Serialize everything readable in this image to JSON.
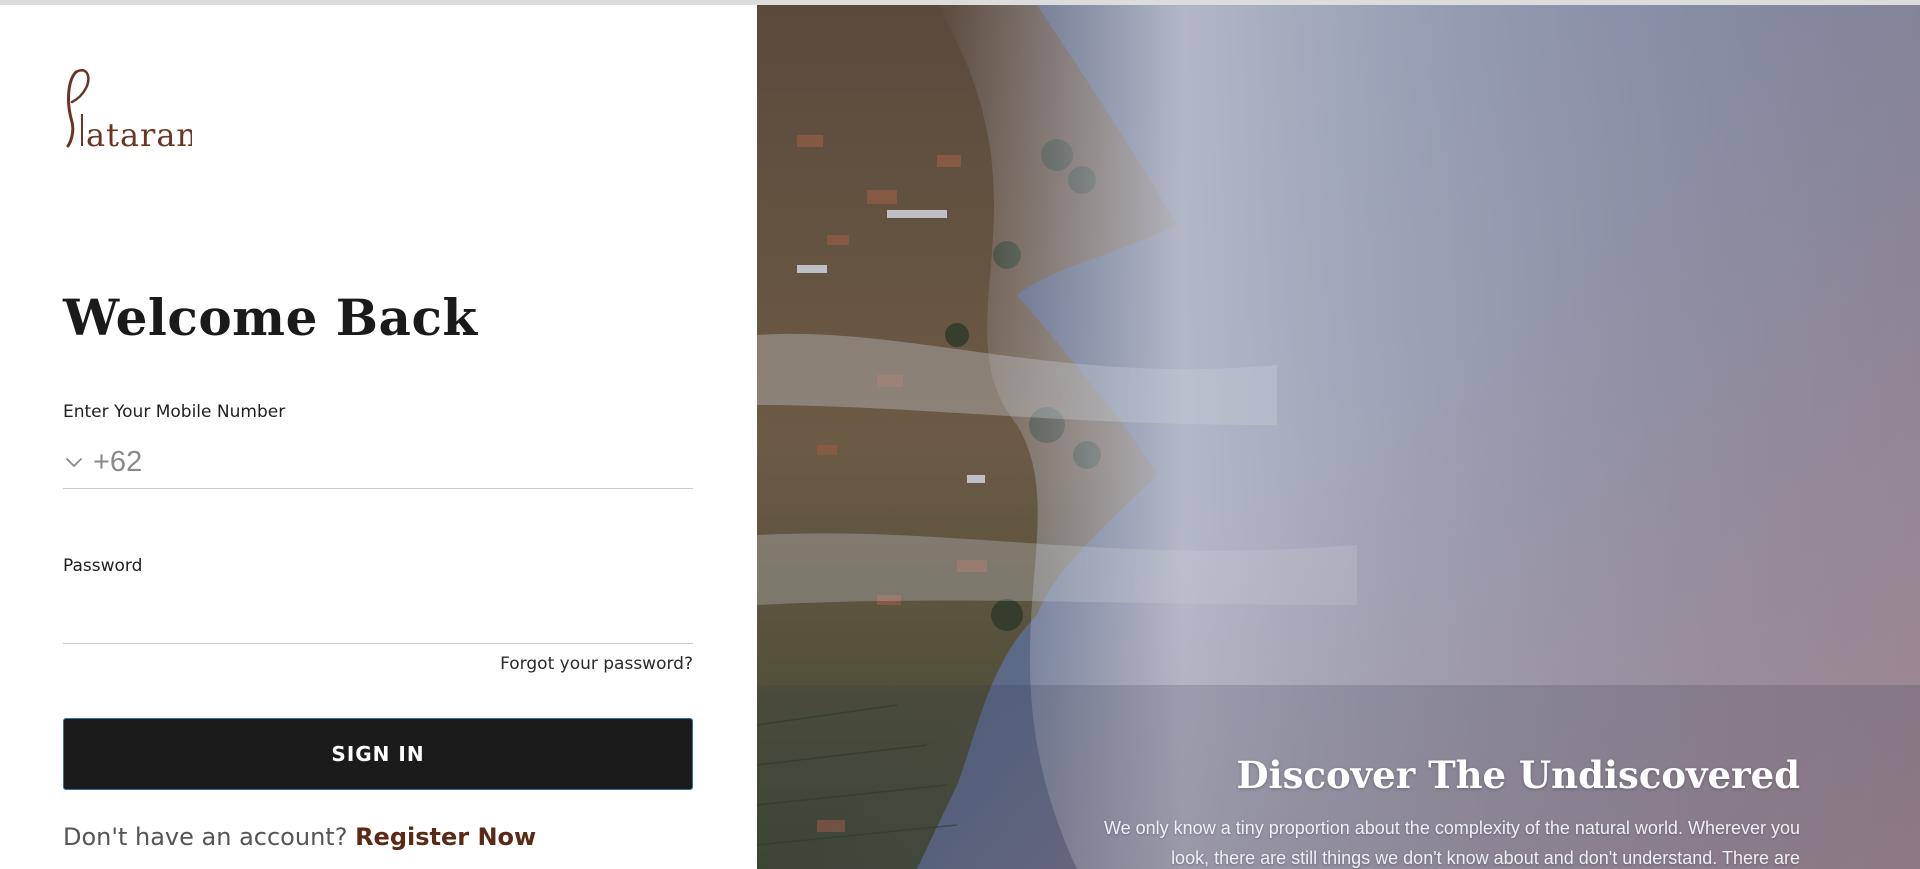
{
  "brand": {
    "logo_text": "Plataran",
    "logo_color": "#6b3524"
  },
  "login": {
    "title": "Welcome Back",
    "mobile_label": "Enter Your Mobile Number",
    "country_code": "+62",
    "password_label": "Password",
    "forgot_link": "Forgot your password?",
    "signin_button": "SIGN IN",
    "register_prompt": "Don't have an account?",
    "register_link": "Register Now"
  },
  "hero": {
    "title": "Discover The Undiscovered",
    "description": "We only know a tiny proportion about the complexity of the natural world. Wherever you look, there are still things we don't know about and don't understand. There are"
  },
  "colors": {
    "button_bg": "#1b1b1b",
    "accent_brown": "#5a2a17",
    "sky": "#5d6a88",
    "mist": "#aeb4c6"
  },
  "icons": {
    "country_dropdown": "chevron-down-icon"
  }
}
